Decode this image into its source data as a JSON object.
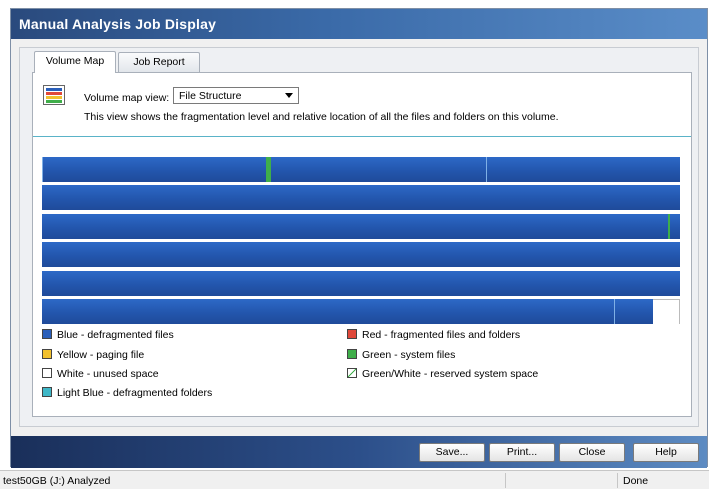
{
  "window": {
    "title": "Manual Analysis Job Display"
  },
  "tabs": [
    {
      "label": "Volume Map",
      "active": true
    },
    {
      "label": "Job Report",
      "active": false
    }
  ],
  "volume_map": {
    "view_label": "Volume map view:",
    "view_selected": "File Structure",
    "description": "This view shows the fragmentation level and relative location of all the files and folders on this volume."
  },
  "legend": [
    {
      "label": "Blue - defragmented files",
      "color": "#2a5fba"
    },
    {
      "label": "Red - fragmented files and folders",
      "color": "#e0483a"
    },
    {
      "label": "Yellow - paging file",
      "color": "#f2c12e"
    },
    {
      "label": "Green - system files",
      "color": "#3fae4a"
    },
    {
      "label": "White - unused space",
      "color": "#ffffff"
    },
    {
      "label": "Green/White - reserved system space",
      "color": "#3fae4a"
    },
    {
      "label": "Light Blue - defragmented folders",
      "color": "#3fb8c8"
    }
  ],
  "buttons": {
    "save": "Save...",
    "print": "Print...",
    "close": "Close",
    "help": "Help"
  },
  "status": {
    "left": "test50GB (J:) Analyzed",
    "right": "Done"
  }
}
